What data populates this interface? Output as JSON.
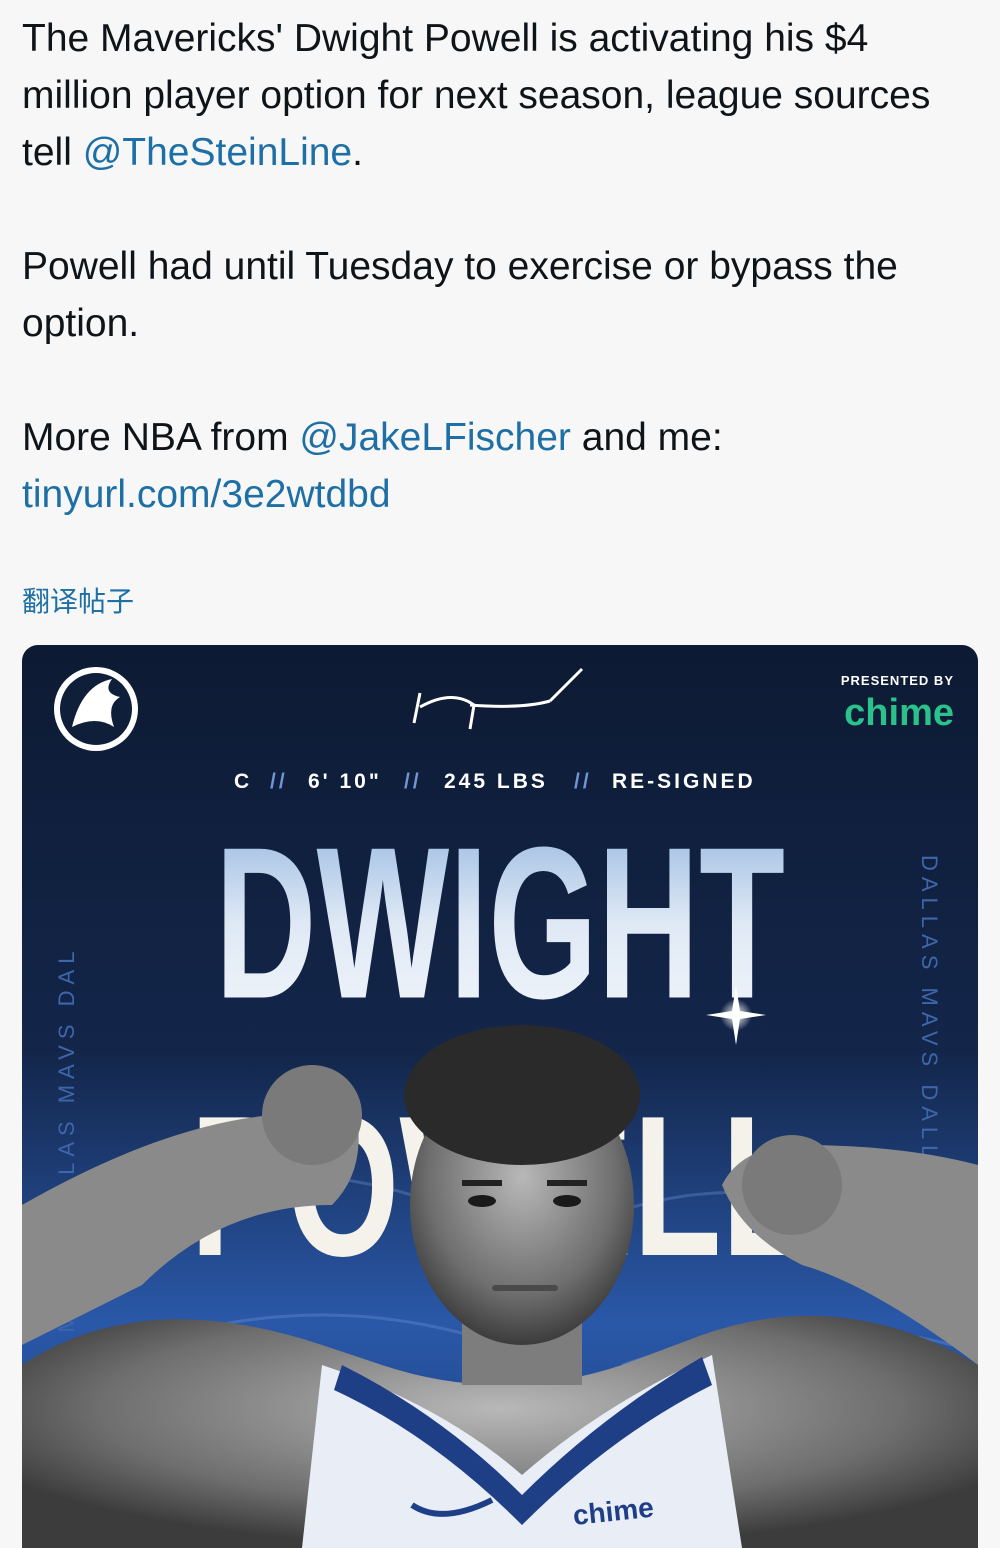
{
  "tweet": {
    "p1": {
      "before": "The Mavericks' Dwight Powell is activating his $4 million player option for next season, league sources tell ",
      "mention": "@TheSteinLine",
      "after": "."
    },
    "p2": "Powell had until Tuesday to exercise or bypass the option.",
    "p3": {
      "before": "More NBA from ",
      "mention": "@JakeLFischer",
      "after": " and me:",
      "url": "tinyurl.com/3e2wtdbd"
    },
    "translate_label": "翻译帖子"
  },
  "poster": {
    "presented_by": "PRESENTED BY",
    "sponsor": "chime",
    "stats": [
      "C",
      "6' 10\"",
      "245 LBS",
      "RE-SIGNED"
    ],
    "stats_sep": "//",
    "first_name": "DWIGHT",
    "last_name": "POWELL",
    "side_text_left": "DALLAS MAVS  DALLAS MAVS  DAL",
    "side_text_right": "DALLAS MAVS  DALLAS",
    "jersey_sponsor": "chime",
    "colors": {
      "navy": "#0f1f3a",
      "blue": "#2f5fae",
      "chime_green": "#2bc18b",
      "link": "#1d6fa5"
    }
  }
}
